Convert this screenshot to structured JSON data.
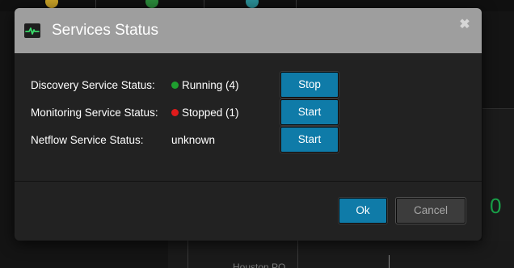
{
  "dialog": {
    "title": "Services Status",
    "close_glyph": "✖",
    "header_icon": "pulse-icon",
    "accent_color": "#0f7ba8",
    "header_color": "#9e9e9e"
  },
  "services": [
    {
      "label": "Discovery Service Status:",
      "status_text": "Running (4)",
      "status_color": "#1f9e2f",
      "has_dot": true,
      "action_label": "Stop"
    },
    {
      "label": "Monitoring Service Status:",
      "status_text": "Stopped (1)",
      "status_color": "#e01b1b",
      "has_dot": true,
      "action_label": "Start"
    },
    {
      "label": "Netflow Service Status:",
      "status_text": "unknown",
      "has_dot": false,
      "action_label": "Start"
    }
  ],
  "footer": {
    "ok_label": "Ok",
    "cancel_label": "Cancel"
  },
  "background": {
    "counter_value": "0",
    "counter_color": "#19a34a",
    "location_label": "Houston PO"
  }
}
